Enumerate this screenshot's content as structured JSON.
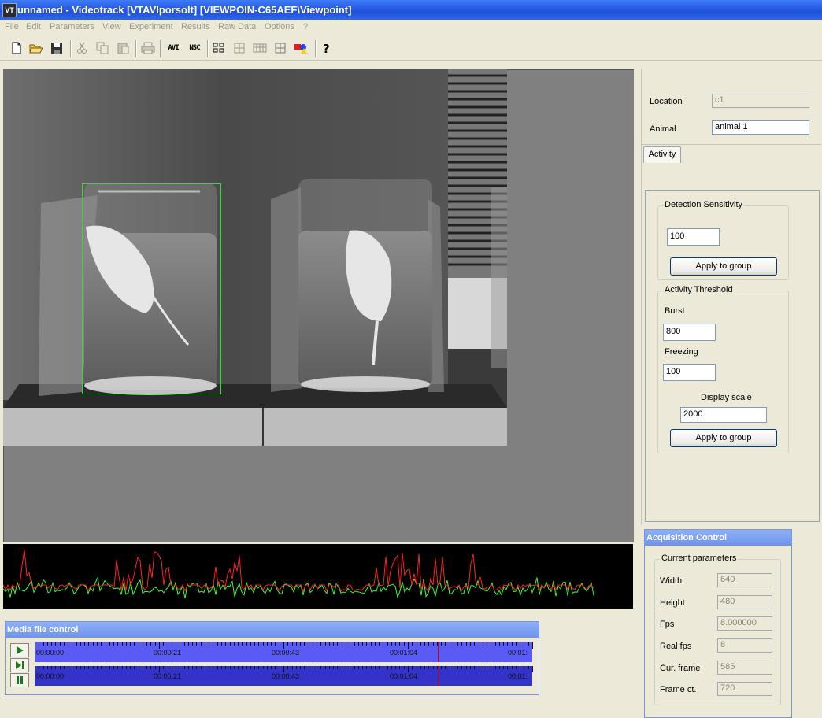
{
  "window": {
    "title": "unnamed - Videotrack [VTAVIporsolt] [VIEWPOIN-C65AEF\\Viewpoint]",
    "app_icon": "VT"
  },
  "menu": [
    "File",
    "Edit",
    "Parameters",
    "View",
    "Experiment",
    "Results",
    "Raw Data",
    "Options",
    "?"
  ],
  "toolbar": {
    "avi_label": "AVI",
    "nsc_label": "NSC"
  },
  "right_panel": {
    "location_label": "Location",
    "location_value": "c1",
    "animal_label": "Animal",
    "animal_value": "animal  1",
    "tab": "Activity",
    "detection": {
      "caption": "Detection  Sensitivity",
      "value": "100",
      "apply": "Apply to group"
    },
    "threshold": {
      "caption": "Activity Threshold",
      "burst_label": "Burst",
      "burst_value": "800",
      "freezing_label": "Freezing",
      "freezing_value": "100",
      "display_scale_label": "Display scale",
      "display_scale_value": "2000",
      "apply": "Apply to group"
    }
  },
  "acquisition": {
    "title": "Acquisition Control",
    "group": "Current parameters",
    "rows": [
      {
        "label": "Width",
        "value": "640"
      },
      {
        "label": "Height",
        "value": "480"
      },
      {
        "label": "Fps",
        "value": "8.000000"
      },
      {
        "label": "Real fps",
        "value": "8"
      },
      {
        "label": "Cur. frame",
        "value": "585"
      },
      {
        "label": "Frame ct.",
        "value": "720"
      }
    ]
  },
  "media": {
    "title": "Media file control",
    "time_labels": [
      "00:00:00",
      "00:00:21",
      "00:00:43",
      "00:01:04",
      "00:01:"
    ],
    "cursor_fraction": 0.81
  },
  "colors": {
    "title_bar": "#2a5ee5",
    "track_top": "#5a5af5",
    "track_bottom": "#3333cc",
    "signal_normal": "#33ff33",
    "signal_burst": "#ff2222",
    "roi_box": "#33dd33",
    "cursor": "#cc0000"
  }
}
